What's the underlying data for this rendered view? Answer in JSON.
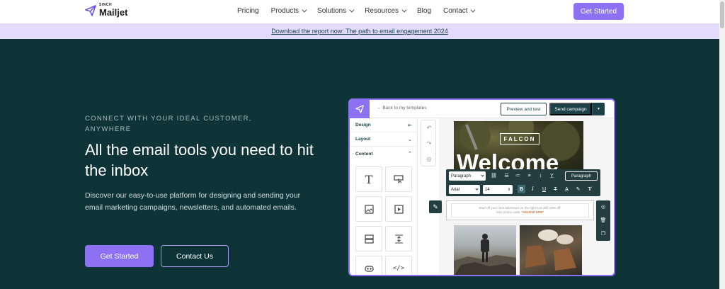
{
  "nav": {
    "logo_small": "SINCH",
    "logo_name": "Mailjet",
    "items": [
      {
        "label": "Pricing",
        "dropdown": false
      },
      {
        "label": "Products",
        "dropdown": true
      },
      {
        "label": "Solutions",
        "dropdown": true
      },
      {
        "label": "Resources",
        "dropdown": true
      },
      {
        "label": "Blog",
        "dropdown": false
      },
      {
        "label": "Contact",
        "dropdown": true
      }
    ],
    "cta": "Get Started"
  },
  "banner": {
    "link": "Download the report now: The path to email engagement 2024"
  },
  "hero": {
    "eyebrow": "CONNECT WITH YOUR IDEAL CUSTOMER, ANYWHERE",
    "headline": "All the email tools you need to hit the inbox",
    "sub": "Discover our easy-to-use platform for designing and sending your email marketing campaigns, newsletters, and automated emails.",
    "primary_button": "Get Started",
    "secondary_button": "Contact Us"
  },
  "editor": {
    "back": "Back to my templates",
    "preview": "Preview and test",
    "send": "Send campaign",
    "sidebar": {
      "design": "Design",
      "layout": "Layout",
      "content": "Content"
    },
    "toolbar": {
      "block": "Paragraph",
      "font": "Arial",
      "size": "14",
      "style": "Paragraph"
    },
    "email": {
      "brand": "FALCON",
      "heading": "Welcome",
      "promo_line": "Start off your next adventure on the right foot with 20% off.",
      "promo_prefix": "Use promo code: ",
      "promo_code": "*ADVENTURE*"
    }
  },
  "colors": {
    "accent": "#8c72f2",
    "background": "#0f3438",
    "banner": "#e3dbfb",
    "editor_dark": "#1b4149"
  }
}
